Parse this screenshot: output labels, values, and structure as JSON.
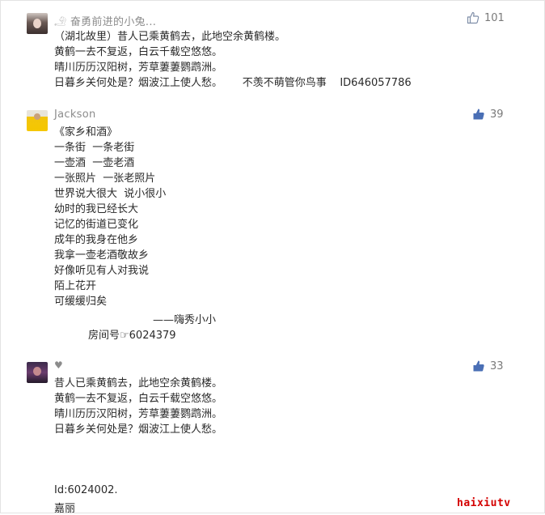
{
  "comments": [
    {
      "username": "𓄂 奋勇前进的小兔...",
      "likes": "101",
      "lines": [
        "（湖北故里）昔人已乘黄鹤去，此地空余黄鹤楼。",
        "黄鹤一去不复返，白云千载空悠悠。",
        "晴川历历汉阳树，芳草萋萋鹦鹉洲。",
        "日暮乡关何处是？烟波江上使人愁。      不羡不萌管你鸟事    ID646057786"
      ]
    },
    {
      "username": "Jackson",
      "likes": "39",
      "lines": [
        "《家乡和酒》",
        "一条街  一条老街",
        "一壶酒  一壶老酒",
        "一张照片  一张老照片",
        "世界说大很大  说小很小",
        "幼时的我已经长大",
        "记忆的街道已变化",
        "成年的我身在他乡",
        "我拿一壶老酒敬故乡",
        "好像听见有人对我说",
        "陌上花开",
        "可缓缓归矣"
      ],
      "signature": "——嗨秀小小",
      "room": "房间号☞6024379"
    },
    {
      "username": "♥",
      "likes": "33",
      "lines": [
        "昔人已乘黄鹤去，此地空余黄鹤楼。",
        "黄鹤一去不复返，白云千载空悠悠。",
        "晴川历历汉阳树，芳草萋萋鹦鹉洲。",
        "日暮乡关何处是？烟波江上使人愁。"
      ],
      "id_line": "Id:6024002.",
      "name_line": "嘉丽"
    }
  ],
  "icons": {
    "like_outline": "thumbs-up-outline-icon",
    "like_filled": "thumbs-up-filled-icon"
  },
  "colors": {
    "like_filled": "#4a6fb5",
    "watermark": "#d40000"
  },
  "watermark": "haixiutv"
}
